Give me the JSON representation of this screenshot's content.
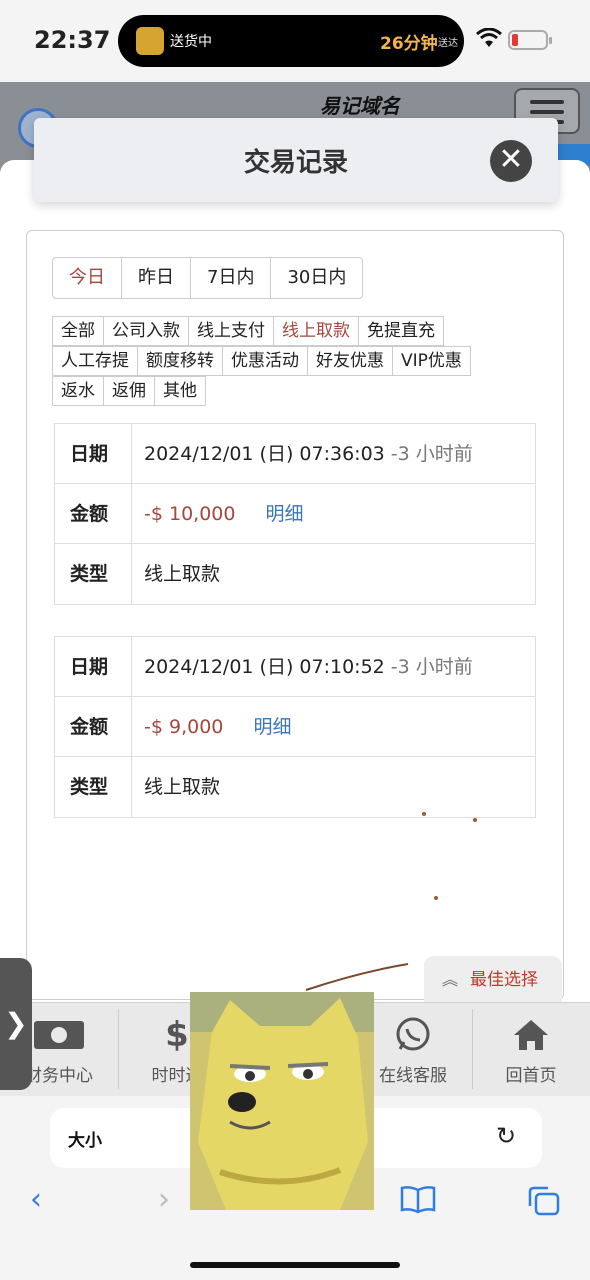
{
  "status_bar": {
    "time": "22:37",
    "live_activity": "送货中",
    "eta": "26分钟",
    "eta_suffix": "送达"
  },
  "site": {
    "title": "易记域名"
  },
  "modal": {
    "title": "交易记录",
    "close_icon": "close-icon"
  },
  "range_tabs": [
    {
      "label": "今日",
      "active": true
    },
    {
      "label": "昨日",
      "active": false
    },
    {
      "label": "7日内",
      "active": false
    },
    {
      "label": "30日内",
      "active": false
    }
  ],
  "filters": {
    "row1": [
      "全部",
      "公司入款",
      "线上支付",
      "线上取款",
      "免提直充"
    ],
    "row2": [
      "人工存提",
      "额度移转",
      "优惠活动",
      "好友优惠",
      "VIP优惠"
    ],
    "row3": [
      "返水",
      "返佣",
      "其他"
    ],
    "active": "线上取款"
  },
  "record_labels": {
    "date": "日期",
    "amount": "金额",
    "type": "类型",
    "detail": "明细"
  },
  "records": [
    {
      "date": "2024/12/01 (日) 07:36:03",
      "ago": "-3 小时前",
      "amount": "-$ 10,000",
      "type": "线上取款"
    },
    {
      "date": "2024/12/01 (日) 07:10:52",
      "ago": "-3 小时前",
      "amount": "-$ 9,000",
      "type": "线上取款"
    }
  ],
  "best_choice": "最佳选择",
  "bottom_nav": [
    {
      "label": "财务中心",
      "icon": "money-icon"
    },
    {
      "label": "时时返",
      "icon": "dollar-icon"
    },
    {
      "label": "",
      "icon": ""
    },
    {
      "label": "在线客服",
      "icon": "whatsapp-icon"
    },
    {
      "label": "回首页",
      "icon": "home-icon"
    }
  ],
  "safari": {
    "url_text": "大小"
  },
  "colors": {
    "accent_red": "#a4473e",
    "link_blue": "#3b76b8",
    "safari_blue": "#2f7fe0"
  }
}
